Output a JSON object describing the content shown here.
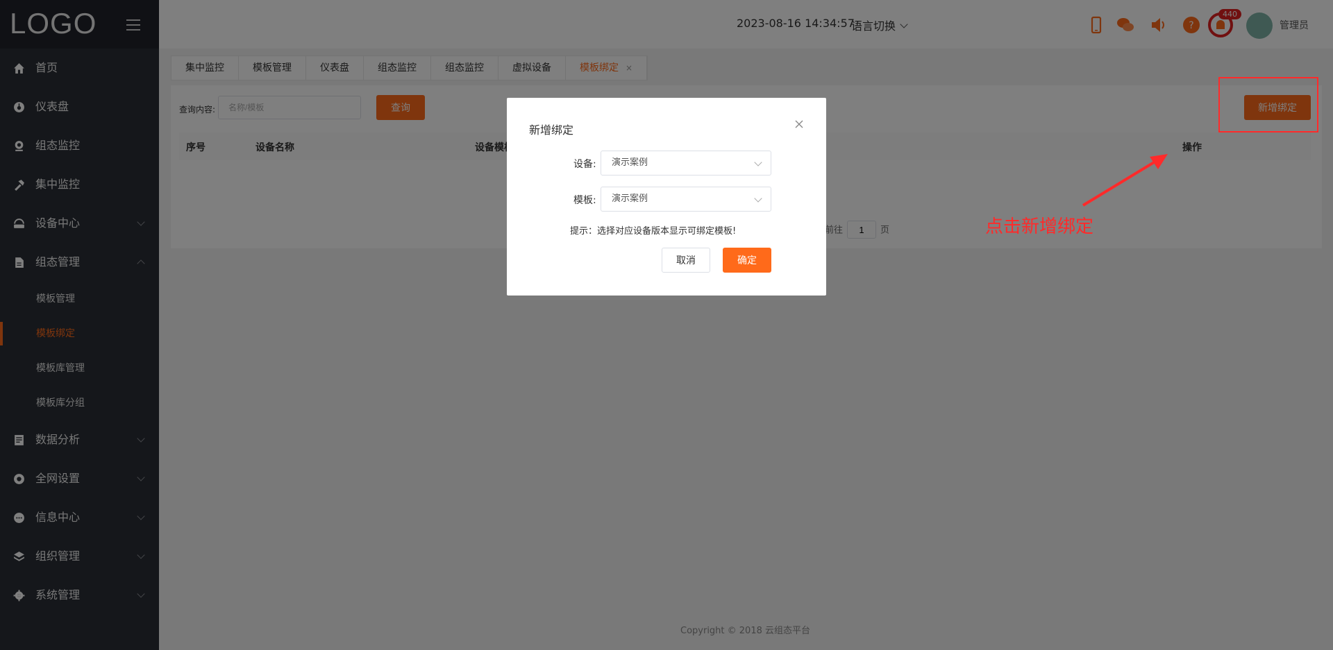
{
  "sidebar": {
    "logo": "LOGO",
    "menu": [
      {
        "label": "首页",
        "icon": "home-icon"
      },
      {
        "label": "仪表盘",
        "icon": "dashboard-icon"
      },
      {
        "label": "组态监控",
        "icon": "monitor-icon"
      },
      {
        "label": "集中监控",
        "icon": "hammer-icon"
      },
      {
        "label": "设备中心",
        "icon": "device-icon"
      },
      {
        "label": "组态管理",
        "icon": "document-icon"
      },
      {
        "label": "数据分析",
        "icon": "chart-icon"
      },
      {
        "label": "全网设置",
        "icon": "network-icon"
      },
      {
        "label": "信息中心",
        "icon": "message-icon"
      },
      {
        "label": "组织管理",
        "icon": "layers-icon"
      },
      {
        "label": "系统管理",
        "icon": "gear-icon"
      }
    ],
    "submenu": [
      {
        "label": "模板管理"
      },
      {
        "label": "模板绑定"
      },
      {
        "label": "模板库管理"
      },
      {
        "label": "模板库分组"
      }
    ]
  },
  "header": {
    "datetime": "2023-08-16 14:34:57",
    "language": "语言切换",
    "notification_count": "440",
    "username": "管理员"
  },
  "tabs": [
    {
      "label": "集中监控"
    },
    {
      "label": "模板管理"
    },
    {
      "label": "仪表盘"
    },
    {
      "label": "组态监控"
    },
    {
      "label": "组态监控"
    },
    {
      "label": "虚拟设备"
    },
    {
      "label": "模板绑定",
      "close": "×"
    }
  ],
  "content": {
    "query_label": "查询内容:",
    "query_placeholder": "名称/模板",
    "query_button": "查询",
    "add_button": "新增绑定",
    "columns": [
      "序号",
      "设备名称",
      "设备模板",
      "操作"
    ],
    "pager_goto": "前往",
    "pager_page": "1",
    "pager_suffix": "页"
  },
  "dialog": {
    "title": "新增绑定",
    "device_label": "设备:",
    "device_value": "演示案例",
    "template_label": "模板:",
    "template_value": "演示案例",
    "tip": "提示：选择对应设备版本显示可绑定模板!",
    "cancel": "取消",
    "confirm": "确定"
  },
  "annotation": {
    "text": "点击新增绑定",
    "color": "#ff2a2a"
  },
  "footer": {
    "copyright": "Copyright © 2018 云组态平台"
  },
  "colors": {
    "accent": "#ff6a1a",
    "sidebar_bg": "#2b2f36"
  }
}
